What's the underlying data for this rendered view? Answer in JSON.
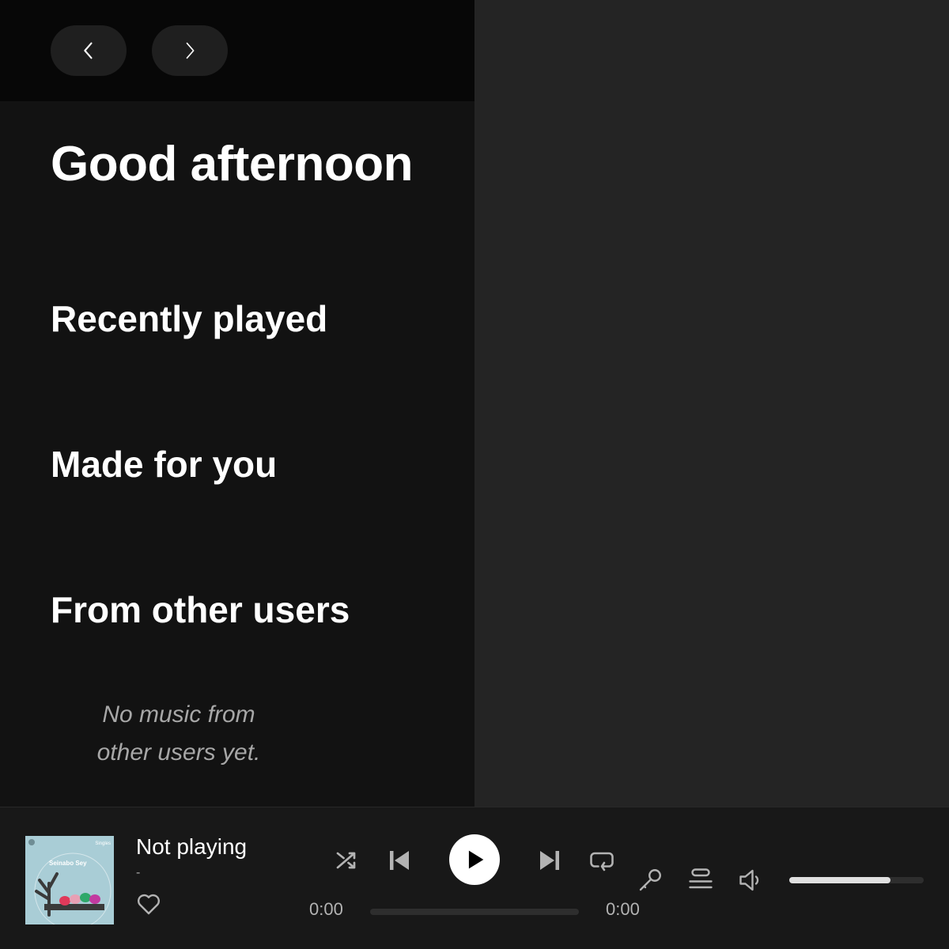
{
  "nav": {
    "back_icon": "chevron-left-icon",
    "forward_icon": "chevron-right-icon"
  },
  "home": {
    "greeting": "Good afternoon",
    "sections": {
      "recently_played": "Recently played",
      "made_for_you": "Made for you",
      "from_other_users": "From other users"
    },
    "empty_state": {
      "line1": "No music from",
      "line2": "other users yet."
    }
  },
  "player": {
    "cover": {
      "artist_text": "Seinabo Sey",
      "badge_text": "Singles"
    },
    "track_title": "Not playing",
    "track_artist": "-",
    "current_time": "0:00",
    "duration": "0:00",
    "progress": 0,
    "volume": 0.75,
    "icons": [
      "heart-icon",
      "shuffle-icon",
      "previous-icon",
      "play-icon",
      "next-icon",
      "repeat-icon",
      "microphone-icon",
      "queue-icon",
      "volume-icon"
    ]
  },
  "colors": {
    "background": "#121212",
    "side_pane": "#242424",
    "player_bar": "#181818",
    "muted_text": "#a7a7a7"
  }
}
